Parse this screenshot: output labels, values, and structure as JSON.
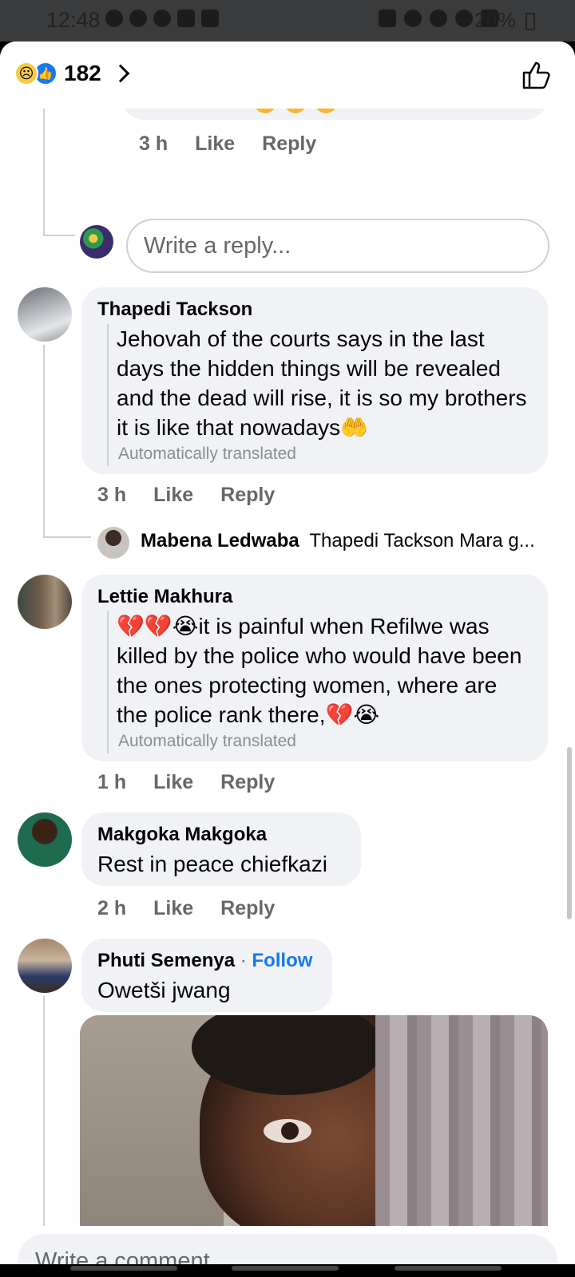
{
  "status_bar": {
    "time": "12:48",
    "battery": "20%"
  },
  "header": {
    "reaction_count": "182"
  },
  "top_partial": {
    "meta": {
      "time": "3 h",
      "like": "Like",
      "reply": "Reply"
    }
  },
  "reply_box": {
    "placeholder": "Write a reply..."
  },
  "comments": [
    {
      "author": "Thapedi Tackson",
      "text": "Jehovah of the courts says in the last days the hidden things will be revealed and the dead will rise, it is so my brothers it is like that nowadays🤲",
      "translated": "Automatically translated",
      "time": "3 h",
      "like": "Like",
      "reply": "Reply"
    },
    {
      "author": "Lettie Makhura",
      "text": "💔💔😭it is painful when Refilwe was killed by the police who would have been the ones protecting women, where are the police rank there,💔😭",
      "translated": "Automatically translated",
      "time": "1 h",
      "like": "Like",
      "reply": "Reply"
    },
    {
      "author": "Makgoka Makgoka",
      "text": "Rest in peace chiefkazi",
      "time": "2 h",
      "like": "Like",
      "reply": "Reply"
    },
    {
      "author": "Phuti Semenya",
      "follow": "Follow",
      "separator": "·",
      "text": "Owetši jwang"
    }
  ],
  "nested_reply": {
    "author": "Mabena Ledwaba",
    "preview": "Thapedi Tackson Mara g..."
  },
  "comment_box": {
    "placeholder": "Write a comment..."
  },
  "colors": {
    "accent": "#1877f2",
    "bubble": "#f0f2f5",
    "meta": "#65676b"
  }
}
